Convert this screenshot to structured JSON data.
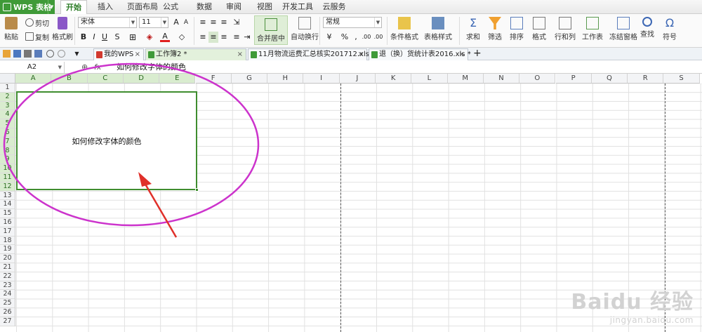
{
  "app": {
    "menu_button": "WPS 表格"
  },
  "menu_tabs": [
    "开始",
    "插入",
    "页面布局",
    "公式",
    "数据",
    "审阅",
    "视图",
    "开发工具",
    "云服务"
  ],
  "ribbon": {
    "paste": "粘贴",
    "cut": "剪切",
    "copy": "复制",
    "format_painter": "格式刷",
    "font_name": "宋体",
    "font_size": "11",
    "bold": "B",
    "italic": "I",
    "underline": "U",
    "merge_center": "合并居中",
    "wrap_text": "自动换行",
    "number_format": "常规",
    "percent": "%",
    "comma": ",",
    "inc_decimal": ".00",
    "dec_decimal": ".00",
    "cond_format": "条件格式",
    "table_style": "表格样式",
    "sum": "求和",
    "filter": "筛选",
    "sort": "排序",
    "format": "格式",
    "row_col": "行和列",
    "worksheet": "工作表",
    "freeze": "冻结窗格",
    "find": "查找",
    "symbol": "符号"
  },
  "doc_tabs": [
    {
      "label": "我的WPS",
      "active": false
    },
    {
      "label": "工作簿2 *",
      "active": true
    },
    {
      "label": "11月物流运费汇总核实201712.xls *",
      "active": false
    },
    {
      "label": "退（换）货统计表2016.xls *",
      "active": false
    }
  ],
  "formula_bar": {
    "name_box": "A2",
    "fx": "fx",
    "content": "如何修改字体的颜色"
  },
  "columns": [
    "A",
    "B",
    "C",
    "D",
    "E",
    "F",
    "G",
    "H",
    "I",
    "J",
    "K",
    "L",
    "M",
    "N",
    "O",
    "P",
    "Q",
    "R",
    "S"
  ],
  "selected_columns": [
    "A",
    "B",
    "C",
    "D",
    "E"
  ],
  "rows": [
    "1",
    "2",
    "3",
    "4",
    "5",
    "6",
    "7",
    "8",
    "9",
    "10",
    "11",
    "12",
    "13",
    "14",
    "15",
    "16",
    "17",
    "18",
    "19",
    "20",
    "21",
    "22",
    "23",
    "24",
    "25",
    "26",
    "27"
  ],
  "selected_rows": [
    "2",
    "3",
    "4",
    "5",
    "6",
    "7",
    "8",
    "9",
    "10",
    "11",
    "12"
  ],
  "cell_text": "如何修改字体的颜色",
  "colors": {
    "accent": "#3f9a38",
    "annotation_ellipse": "#cc33cc",
    "annotation_arrow": "#e0302a",
    "selection": "#3f8d2f"
  },
  "watermark": {
    "logo": "Baidu 经验",
    "url": "jingyan.baidu.com"
  }
}
